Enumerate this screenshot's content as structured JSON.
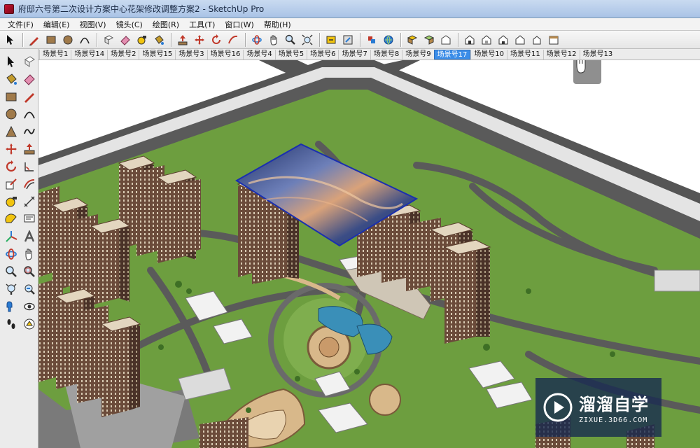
{
  "window": {
    "title": "府邸六号第二次设计方案中心花架修改调整方案2 - SketchUp Pro"
  },
  "menu": [
    {
      "label": "文件(F)"
    },
    {
      "label": "编辑(E)"
    },
    {
      "label": "视图(V)"
    },
    {
      "label": "镜头(C)"
    },
    {
      "label": "绘图(R)"
    },
    {
      "label": "工具(T)"
    },
    {
      "label": "窗口(W)"
    },
    {
      "label": "帮助(H)"
    }
  ],
  "scene_tabs": [
    {
      "label": "场景号1"
    },
    {
      "label": "场景号14"
    },
    {
      "label": "场景号2"
    },
    {
      "label": "场景号15"
    },
    {
      "label": "场景号3"
    },
    {
      "label": "场景号16"
    },
    {
      "label": "场景号4"
    },
    {
      "label": "场景号5"
    },
    {
      "label": "场景号6"
    },
    {
      "label": "场景号7"
    },
    {
      "label": "场景号8"
    },
    {
      "label": "场景号9"
    },
    {
      "label": "场景号17",
      "active": true
    },
    {
      "label": "场景号10"
    },
    {
      "label": "场景号11"
    },
    {
      "label": "场景号12"
    },
    {
      "label": "场景号13"
    }
  ],
  "toolbar_icons": [
    "select-icon",
    "pencil-icon",
    "rectangle-icon",
    "circle-icon",
    "arc-icon",
    "make-component-icon",
    "eraser-icon",
    "paint-bucket-icon",
    "tape-measure-icon",
    "push-pull-icon",
    "move-icon",
    "rotate-icon",
    "follow-me-icon",
    "orbit-icon",
    "pan-icon",
    "zoom-icon",
    "zoom-extents-icon",
    "previous-view-icon",
    "next-view-icon",
    "standard-view-icon",
    "get-models-icon",
    "share-model-icon",
    "component-icon",
    "iso-view-icon",
    "top-view-icon",
    "front-view-icon",
    "right-view-icon",
    "back-view-icon",
    "left-view-icon"
  ],
  "palette_icons": [
    "select-icon",
    "make-component-icon",
    "paint-bucket-icon",
    "eraser-icon",
    "rectangle-icon",
    "line-icon",
    "circle-icon",
    "arc-icon",
    "polygon-icon",
    "freehand-icon",
    "move-icon",
    "push-pull-icon",
    "rotate-icon",
    "follow-me-icon",
    "scale-icon",
    "offset-icon",
    "tape-measure-icon",
    "dimension-icon",
    "protractor-icon",
    "text-icon",
    "axes-icon",
    "3d-text-icon",
    "orbit-icon",
    "pan-icon",
    "zoom-icon",
    "zoom-window-icon",
    "zoom-extents-icon",
    "previous-icon",
    "position-camera-icon",
    "look-around-icon",
    "walk-icon",
    "section-plane-icon"
  ],
  "watermark": {
    "brand": "溜溜自学",
    "url": "ZIXUE.3D66.COM"
  },
  "colors": {
    "lawn": "#6d9e3f",
    "road": "#5e5e5e",
    "building": "#6b4b3a",
    "active_tab": "#3b8de8"
  }
}
